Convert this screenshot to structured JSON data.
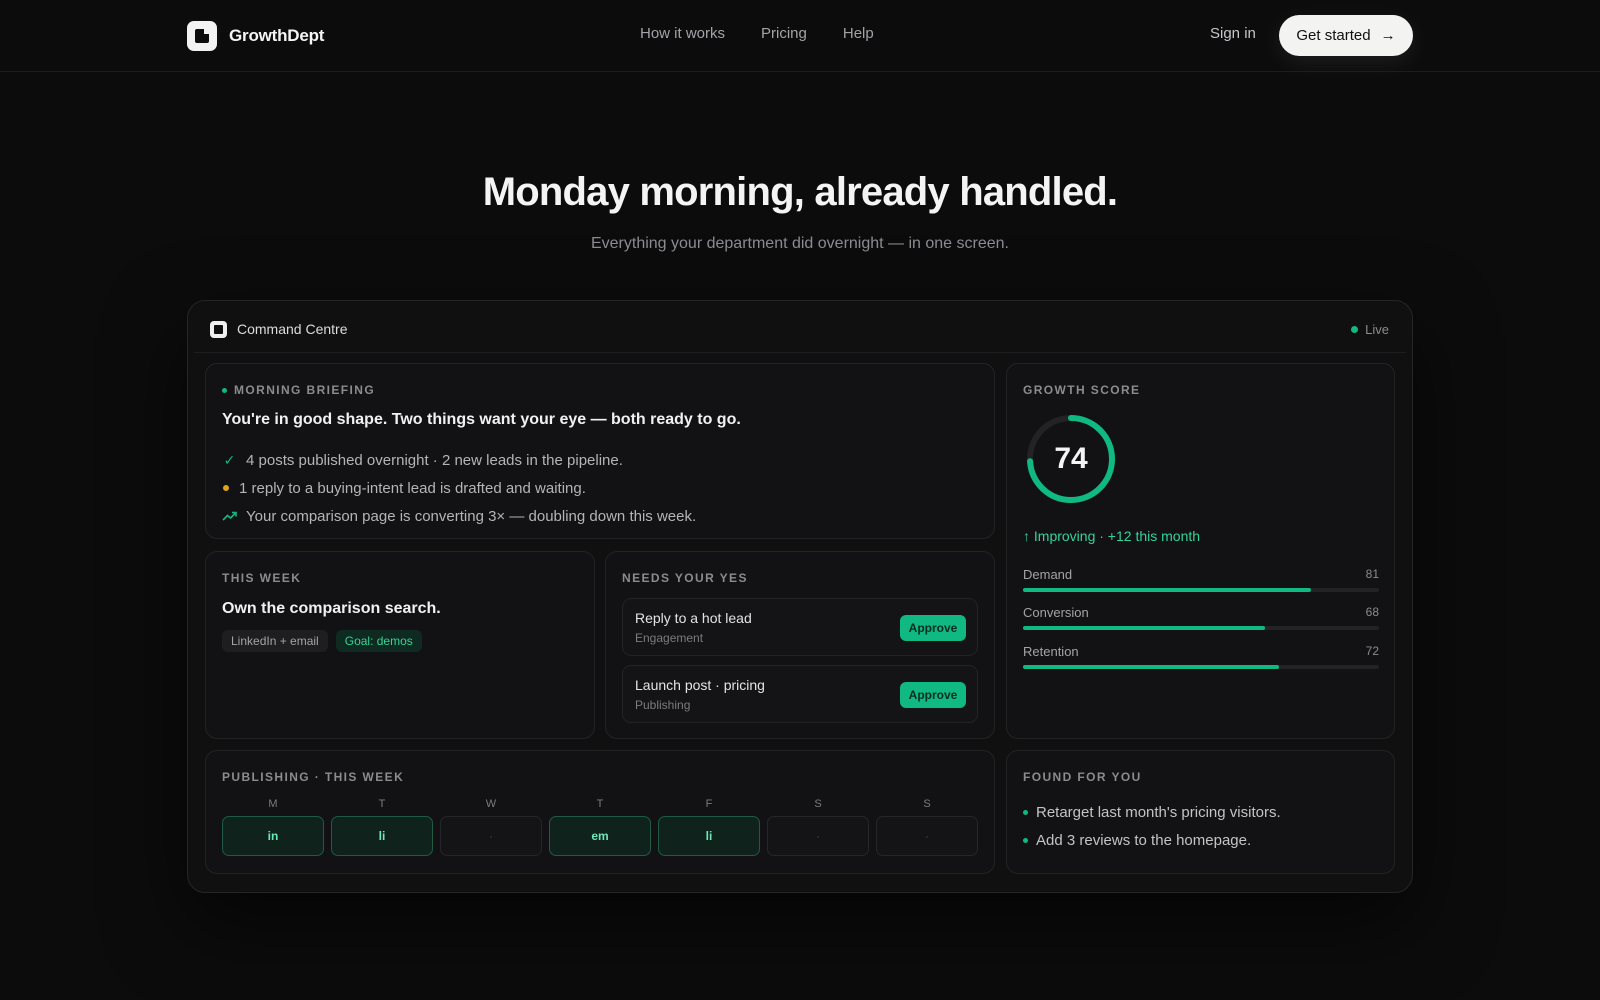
{
  "nav": {
    "brand": "GrowthDept",
    "links": [
      "How it works",
      "Pricing",
      "Help"
    ],
    "signin": "Sign in",
    "cta": "Get started"
  },
  "hero": {
    "title": "Monday morning, already handled.",
    "subtitle": "Everything your department did overnight — in one screen."
  },
  "app": {
    "title": "Command Centre",
    "status": "Live",
    "briefing": {
      "label": "MORNING BRIEFING",
      "headline": "You're in good shape. Two things want your eye — both ready to go.",
      "items": [
        {
          "icon": "check-icon",
          "text": "4 posts published overnight · 2 new leads in the pipeline."
        },
        {
          "icon": "amber-dot-icon",
          "text": "1 reply to a buying-intent lead is drafted and waiting."
        },
        {
          "icon": "trend-up-icon",
          "text": "Your comparison page is converting 3× — doubling down this week."
        }
      ]
    },
    "score": {
      "label": "GROWTH SCORE",
      "value": "74",
      "value_fraction": 0.74,
      "trend": "Improving · +12 this month",
      "metrics": [
        {
          "name": "Demand",
          "value": "81",
          "fraction": 0.81
        },
        {
          "name": "Conversion",
          "value": "68",
          "fraction": 0.68
        },
        {
          "name": "Retention",
          "value": "72",
          "fraction": 0.72
        }
      ]
    },
    "week": {
      "label": "THIS WEEK",
      "headline": "Own the comparison search.",
      "chips": [
        "LinkedIn + email",
        "Goal: demos"
      ]
    },
    "yes": {
      "label": "NEEDS YOUR YES",
      "tasks": [
        {
          "title": "Reply to a hot lead",
          "sub": "Engagement",
          "action": "Approve"
        },
        {
          "title": "Launch post · pricing",
          "sub": "Publishing",
          "action": "Approve"
        }
      ]
    },
    "publishing": {
      "label": "PUBLISHING · THIS WEEK",
      "days": [
        {
          "day": "M",
          "value": "in",
          "active": true
        },
        {
          "day": "T",
          "value": "li",
          "active": true
        },
        {
          "day": "W",
          "value": "·",
          "active": false
        },
        {
          "day": "T",
          "value": "em",
          "active": true
        },
        {
          "day": "F",
          "value": "li",
          "active": true
        },
        {
          "day": "S",
          "value": "·",
          "active": false
        },
        {
          "day": "S",
          "value": "·",
          "active": false
        }
      ]
    },
    "found": {
      "label": "FOUND FOR YOU",
      "items": [
        "Retarget last month's pricing visitors.",
        "Add 3 reviews to the homepage."
      ]
    }
  },
  "colors": {
    "accent": "#10b981",
    "amber": "#e0a418",
    "background": "#0c0c0d"
  }
}
